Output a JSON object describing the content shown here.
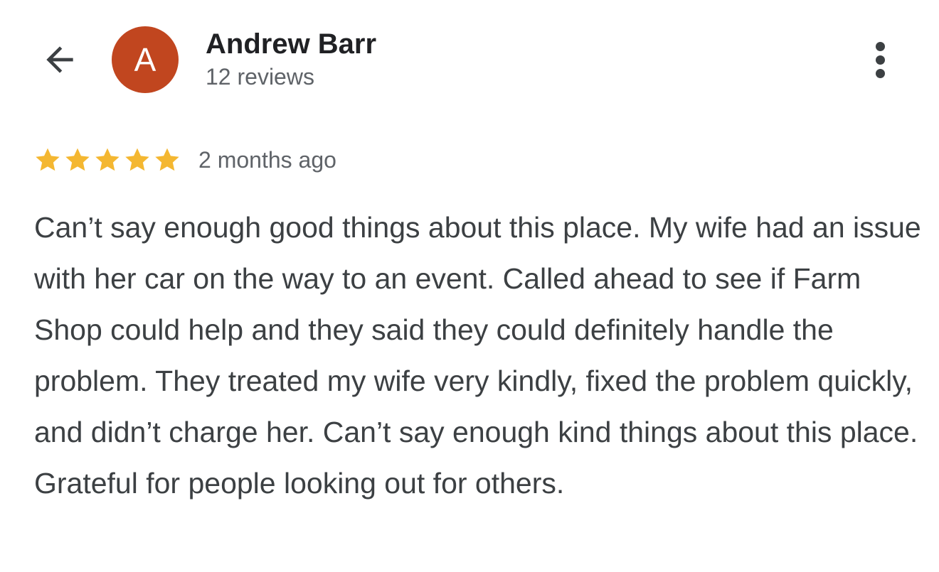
{
  "header": {
    "back_icon": "arrow-left-icon",
    "reviewer_initial": "A",
    "reviewer_name": "Andrew Barr",
    "review_count": "12 reviews",
    "more_icon": "more-vertical-icon",
    "avatar_color": "#c1461f"
  },
  "review": {
    "rating": 5,
    "rating_max": 5,
    "star_color": "#f4b731",
    "time": "2 months ago",
    "text": "Can’t say enough good things about this place. My wife had an issue with her car on the way to an event. Called ahead to see if Farm Shop could help and they said they could definitely handle the problem. They treated my wife very kindly, fixed the problem quickly, and didn’t charge her. Can’t say enough kind things about this place. Grateful for people looking out for others."
  }
}
